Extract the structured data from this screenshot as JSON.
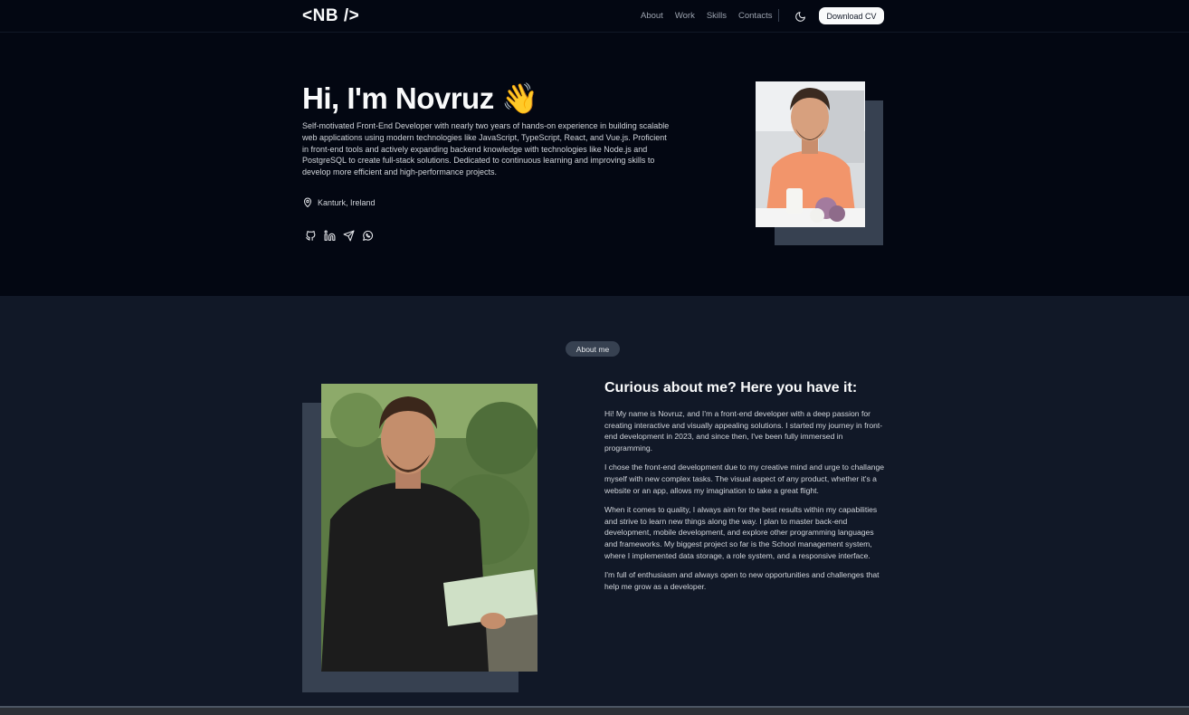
{
  "header": {
    "logo": "<NB />",
    "nav": [
      "About",
      "Work",
      "Skills",
      "Contacts"
    ],
    "theme_icon": "moon-icon",
    "download_cv": "Download CV"
  },
  "hero": {
    "title": "Hi, I'm Novruz 👋",
    "description": "Self-motivated Front-End Developer with nearly two years of hands-on experience in building scalable web applications using modern technologies like JavaScript, TypeScript, React, and Vue.js. Proficient in front-end tools and actively expanding backend knowledge with technologies like Node.js and PostgreSQL to create full-stack solutions. Dedicated to continuous learning and improving skills to develop more efficient and high-performance projects.",
    "location": "Kanturk, Ireland",
    "socials": [
      "github-icon",
      "linkedin-icon",
      "telegram-icon",
      "whatsapp-icon"
    ]
  },
  "about": {
    "badge": "About me",
    "title": "Curious about me? Here you have it:",
    "paragraphs": [
      "Hi! My name is Novruz, and I'm a front-end developer with a deep passion for creating interactive and visually appealing solutions. I started my journey in front-end development in 2023, and since then, I've been fully immersed in programming.",
      "I chose the front-end development due to my creative mind and urge to challange myself with new complex tasks. The visual aspect of any product, whether it's a website or an app, allows my imagination to take a great flight.",
      "When it comes to quality, I always aim for the best results within my capabilities and strive to learn new things along the way. I plan to master back-end development, mobile development, and explore other programming languages and frameworks. My biggest project so far is the School management system, where I implemented data storage, a role system, and a responsive interface.",
      "I'm full of enthusiasm and always open to new opportunities and challenges that help me grow as a developer."
    ]
  },
  "colors": {
    "hero_bg": "#030712",
    "about_bg": "#111827",
    "accent_block": "#374151"
  }
}
